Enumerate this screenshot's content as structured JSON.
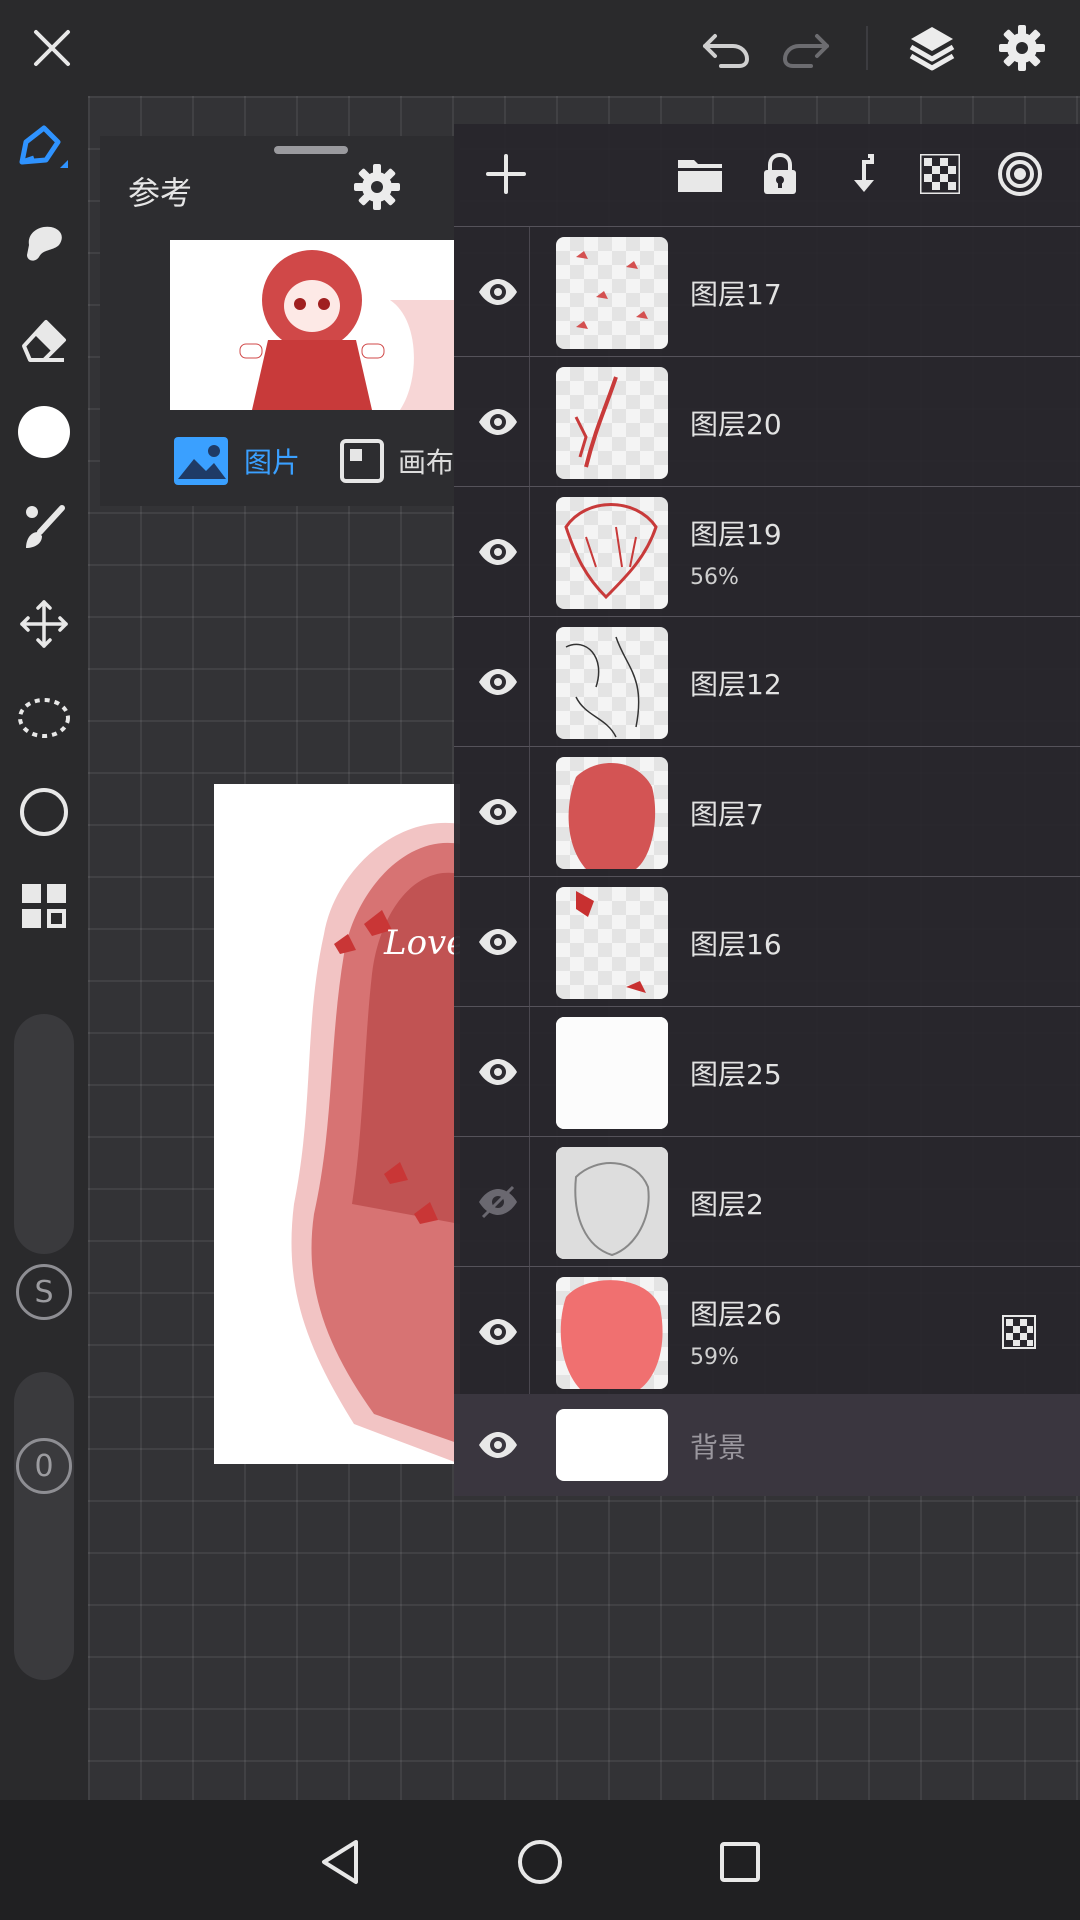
{
  "reference_panel": {
    "title": "参考",
    "tab_picture": "图片",
    "tab_canvas": "画布"
  },
  "layers": [
    {
      "name": "图层17",
      "opacity": "",
      "visible": true
    },
    {
      "name": "图层20",
      "opacity": "",
      "visible": true
    },
    {
      "name": "图层19",
      "opacity": "56%",
      "visible": true
    },
    {
      "name": "图层12",
      "opacity": "",
      "visible": true
    },
    {
      "name": "图层7",
      "opacity": "",
      "visible": true
    },
    {
      "name": "图层16",
      "opacity": "",
      "visible": true
    },
    {
      "name": "图层25",
      "opacity": "",
      "visible": true
    },
    {
      "name": "图层2",
      "opacity": "",
      "visible": false
    },
    {
      "name": "图层26",
      "opacity": "59%",
      "visible": true,
      "clipping": true
    }
  ],
  "background_layer": {
    "name": "背景"
  },
  "left_toolbar": {
    "stabilizer_badge": "S",
    "size_badge": "0"
  },
  "colors": {
    "accent": "#3aa0ff",
    "current_color": "#ffffff",
    "layer_red": "#e46767"
  }
}
